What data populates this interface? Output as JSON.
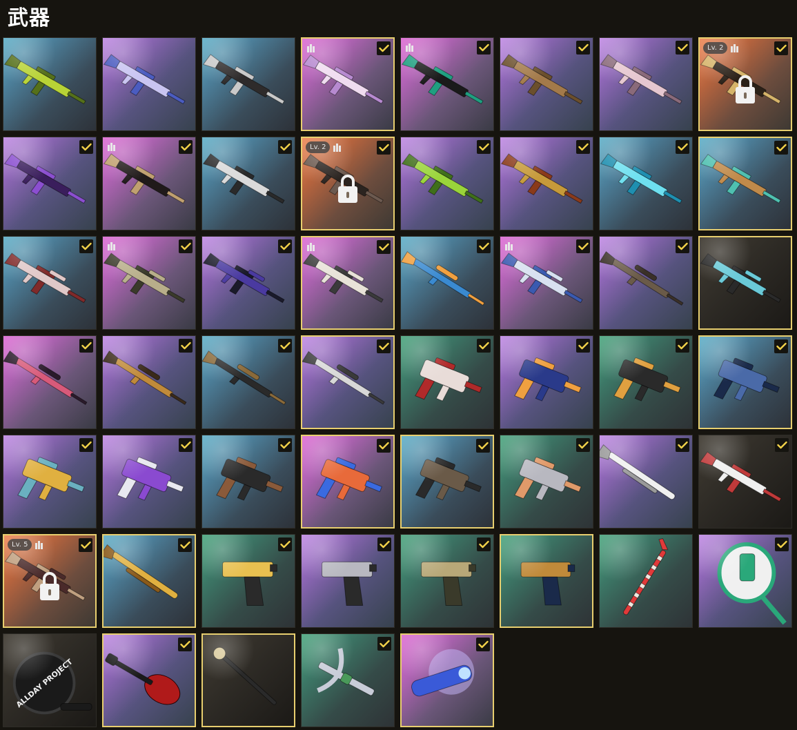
{
  "page_title": "武器",
  "colors": {
    "selected_border": "#e8cf6f",
    "check": "#f2d24a",
    "background": "#16140f"
  },
  "items": [
    {
      "name": "rifle-yellow-camo",
      "rarity": "blue",
      "bg": "blue",
      "selected": false,
      "owned": false,
      "icon": "assault-rifle",
      "colors": [
        "#b8d336",
        "#55701a"
      ]
    },
    {
      "name": "rifle-white-blue",
      "rarity": "purple",
      "bg": "purple",
      "selected": false,
      "owned": false,
      "icon": "assault-rifle",
      "colors": [
        "#c9c4f2",
        "#4b5cc0"
      ]
    },
    {
      "name": "rifle-black-white",
      "rarity": "blue",
      "bg": "blue",
      "selected": false,
      "owned": false,
      "icon": "assault-rifle",
      "colors": [
        "#2e2b2b",
        "#c9c9c9"
      ]
    },
    {
      "name": "rifle-pink-white",
      "rarity": "pink",
      "bg": "pink",
      "selected": true,
      "owned": true,
      "bars": true,
      "icon": "assault-rifle",
      "colors": [
        "#f0dcf0",
        "#b78ad0"
      ]
    },
    {
      "name": "rifle-teal-black",
      "rarity": "pink",
      "bg": "pink",
      "selected": false,
      "owned": true,
      "bars": true,
      "icon": "assault-rifle",
      "colors": [
        "#1a1a1a",
        "#1f9f80"
      ]
    },
    {
      "name": "rifle-bronze",
      "rarity": "purple",
      "bg": "purple",
      "selected": false,
      "owned": true,
      "icon": "assault-rifle",
      "colors": [
        "#a37a4a",
        "#6b4f2c"
      ]
    },
    {
      "name": "rifle-pink-floral",
      "rarity": "purple",
      "bg": "purple",
      "selected": false,
      "owned": true,
      "icon": "assault-rifle",
      "colors": [
        "#e6c7d0",
        "#8a6a7a"
      ]
    },
    {
      "name": "rifle-gold-locked",
      "rarity": "orange",
      "bg": "orange",
      "selected": true,
      "owned": true,
      "locked": true,
      "level": "Lv. 2",
      "bars": true,
      "icon": "assault-rifle",
      "colors": [
        "#2b2118",
        "#d6b46a"
      ]
    },
    {
      "name": "smg-purple-black",
      "rarity": "purple",
      "bg": "purple",
      "selected": false,
      "owned": true,
      "icon": "bullpup",
      "colors": [
        "#3a1e5c",
        "#8b4fd0"
      ]
    },
    {
      "name": "rifle-black-gold",
      "rarity": "pink",
      "bg": "pink",
      "selected": false,
      "owned": true,
      "bars": true,
      "icon": "assault-rifle",
      "colors": [
        "#201a1a",
        "#c0a070"
      ]
    },
    {
      "name": "rifle-white-black",
      "rarity": "blue",
      "bg": "blue",
      "selected": false,
      "owned": true,
      "icon": "assault-rifle",
      "colors": [
        "#dadada",
        "#2a2a2a"
      ]
    },
    {
      "name": "rifle-orange-locked",
      "rarity": "orange",
      "bg": "orange",
      "selected": true,
      "owned": true,
      "locked": true,
      "level": "Lv. 2",
      "bars": true,
      "icon": "assault-rifle",
      "colors": [
        "#2b2420",
        "#6c5a50"
      ]
    },
    {
      "name": "rifle-green-lime",
      "rarity": "purple",
      "bg": "purple",
      "selected": false,
      "owned": true,
      "icon": "assault-rifle",
      "colors": [
        "#9ad43a",
        "#3f6f1a"
      ]
    },
    {
      "name": "rifle-gold-bullpup",
      "rarity": "purple",
      "bg": "purple",
      "selected": false,
      "owned": true,
      "icon": "bullpup",
      "colors": [
        "#c69a3a",
        "#8a3a1a"
      ]
    },
    {
      "name": "rifle-cyan",
      "rarity": "blue",
      "bg": "blue",
      "selected": false,
      "owned": true,
      "icon": "assault-rifle",
      "colors": [
        "#6ee0f0",
        "#1f8fb0"
      ]
    },
    {
      "name": "rifle-m16-teal",
      "rarity": "blue",
      "bg": "blue",
      "selected": true,
      "owned": true,
      "icon": "assault-rifle",
      "colors": [
        "#c08a4a",
        "#4fc0b0"
      ]
    },
    {
      "name": "dmr-floral",
      "rarity": "purple",
      "bg": "blue",
      "selected": false,
      "owned": true,
      "icon": "dmr",
      "colors": [
        "#e0c8c8",
        "#802a2a"
      ]
    },
    {
      "name": "dmr-khaki",
      "rarity": "pink",
      "bg": "pink",
      "selected": false,
      "owned": true,
      "bars": true,
      "icon": "dmr",
      "colors": [
        "#b8ae8a",
        "#3a3a2a"
      ]
    },
    {
      "name": "dmr-purple",
      "rarity": "purple",
      "bg": "purple",
      "selected": false,
      "owned": true,
      "icon": "dmr",
      "colors": [
        "#4a3aa0",
        "#1a1a2a"
      ]
    },
    {
      "name": "dmr-white",
      "rarity": "pink",
      "bg": "pink",
      "selected": true,
      "owned": true,
      "bars": true,
      "icon": "dmr",
      "colors": [
        "#e8e2d8",
        "#3a3a3a"
      ]
    },
    {
      "name": "sniper-blue-orange",
      "rarity": "blue",
      "bg": "blue",
      "selected": false,
      "owned": true,
      "icon": "sniper",
      "colors": [
        "#3a8ad0",
        "#f0a040"
      ]
    },
    {
      "name": "dmr-blue-white",
      "rarity": "pink",
      "bg": "pink",
      "selected": false,
      "owned": true,
      "bars": true,
      "icon": "dmr",
      "colors": [
        "#d8e0f0",
        "#3a5ab0"
      ]
    },
    {
      "name": "sniper-brown",
      "rarity": "purple",
      "bg": "purple",
      "selected": false,
      "owned": true,
      "icon": "sniper",
      "colors": [
        "#6a5a48",
        "#3a3028"
      ]
    },
    {
      "name": "dmr-dark-teal",
      "rarity": "dark",
      "bg": "dark",
      "selected": true,
      "owned": false,
      "icon": "dmr",
      "colors": [
        "#6acad8",
        "#2a2a2a"
      ]
    },
    {
      "name": "sniper-pink",
      "rarity": "pink",
      "bg": "pink",
      "selected": false,
      "owned": true,
      "icon": "sniper",
      "colors": [
        "#d85a7a",
        "#2a1a2a"
      ]
    },
    {
      "name": "sniper-gold",
      "rarity": "purple",
      "bg": "purple",
      "selected": false,
      "owned": true,
      "icon": "sniper",
      "colors": [
        "#c08a3a",
        "#3a2a1a"
      ]
    },
    {
      "name": "sniper-black-wood",
      "rarity": "blue",
      "bg": "blue",
      "selected": false,
      "owned": true,
      "icon": "sniper",
      "colors": [
        "#2a2a2a",
        "#8a6a3a"
      ]
    },
    {
      "name": "sniper-white",
      "rarity": "purple",
      "bg": "purple",
      "selected": true,
      "owned": true,
      "icon": "sniper",
      "colors": [
        "#d8d8d8",
        "#3a3a3a"
      ]
    },
    {
      "name": "smg-white-red",
      "rarity": "green",
      "bg": "green",
      "selected": false,
      "owned": true,
      "icon": "smg",
      "colors": [
        "#e8dcd8",
        "#b02a2a"
      ]
    },
    {
      "name": "pistol-blue-orange",
      "rarity": "purple",
      "bg": "purple",
      "selected": false,
      "owned": true,
      "icon": "smg",
      "colors": [
        "#2a3a8a",
        "#f0a040"
      ]
    },
    {
      "name": "smg-black-orange",
      "rarity": "green",
      "bg": "green",
      "selected": false,
      "owned": true,
      "icon": "smg",
      "colors": [
        "#2a2a2a",
        "#e0a040"
      ]
    },
    {
      "name": "smg-blue-camo",
      "rarity": "blue",
      "bg": "blue",
      "selected": true,
      "owned": true,
      "icon": "smg",
      "colors": [
        "#4a6aa8",
        "#1a2a4a"
      ]
    },
    {
      "name": "smg-graffiti",
      "rarity": "purple",
      "bg": "purple",
      "selected": false,
      "owned": true,
      "icon": "smg",
      "colors": [
        "#e0b040",
        "#6ab0c0"
      ]
    },
    {
      "name": "smg-purple-white",
      "rarity": "purple",
      "bg": "purple",
      "selected": false,
      "owned": true,
      "icon": "smg",
      "colors": [
        "#8a4ad0",
        "#e8e8f0"
      ]
    },
    {
      "name": "smg-tommy",
      "rarity": "blue",
      "bg": "blue",
      "selected": false,
      "owned": true,
      "icon": "smg",
      "colors": [
        "#2a2a2a",
        "#8a5a3a"
      ]
    },
    {
      "name": "smg-rainbow",
      "rarity": "pink",
      "bg": "pink",
      "selected": true,
      "owned": true,
      "icon": "smg",
      "colors": [
        "#e86a3a",
        "#3a6ae0"
      ]
    },
    {
      "name": "lmg-camo",
      "rarity": "blue",
      "bg": "blue",
      "selected": true,
      "owned": true,
      "icon": "lmg",
      "colors": [
        "#6a5a48",
        "#2a2a2a"
      ]
    },
    {
      "name": "shotgun-grey-orange",
      "rarity": "green",
      "bg": "green",
      "selected": false,
      "owned": true,
      "icon": "smg",
      "colors": [
        "#b8b8c0",
        "#e09a6a"
      ]
    },
    {
      "name": "shotgun-white",
      "rarity": "purple",
      "bg": "purple",
      "selected": false,
      "owned": true,
      "icon": "shotgun",
      "colors": [
        "#f0f0f0",
        "#9a9a9a"
      ]
    },
    {
      "name": "rifle-white-red",
      "rarity": "dark",
      "bg": "dark",
      "selected": false,
      "owned": true,
      "icon": "assault-rifle",
      "colors": [
        "#f0f0f0",
        "#c03a3a"
      ]
    },
    {
      "name": "rifle-red-locked",
      "rarity": "orange",
      "bg": "orange",
      "selected": true,
      "owned": true,
      "locked": true,
      "level": "Lv. 5",
      "bars": true,
      "icon": "dmr",
      "colors": [
        "#4a2a2a",
        "#c0a080"
      ]
    },
    {
      "name": "shotgun-gold",
      "rarity": "blue",
      "bg": "blue",
      "selected": true,
      "owned": true,
      "icon": "shotgun",
      "colors": [
        "#e0b040",
        "#8a5a1a"
      ]
    },
    {
      "name": "pistol-deagle-gold",
      "rarity": "green",
      "bg": "green",
      "selected": false,
      "owned": true,
      "icon": "pistol",
      "colors": [
        "#e8c050",
        "#2a2a2a"
      ]
    },
    {
      "name": "pistol-grey",
      "rarity": "purple",
      "bg": "purple",
      "selected": false,
      "owned": true,
      "icon": "pistol",
      "colors": [
        "#b8b8c0",
        "#2a2a2a"
      ]
    },
    {
      "name": "pistol-tan",
      "rarity": "green",
      "bg": "green",
      "selected": false,
      "owned": true,
      "icon": "pistol",
      "colors": [
        "#b8a878",
        "#3a3a2a"
      ]
    },
    {
      "name": "pistol-leopard",
      "rarity": "green",
      "bg": "green",
      "selected": true,
      "owned": false,
      "icon": "pistol",
      "colors": [
        "#c08a3a",
        "#1a2a4a"
      ]
    },
    {
      "name": "crowbar-candy",
      "rarity": "green",
      "bg": "green",
      "selected": false,
      "owned": false,
      "icon": "crowbar",
      "colors": [
        "#e03a3a",
        "#f0e8e0"
      ]
    },
    {
      "name": "racket-green",
      "rarity": "purple",
      "bg": "purple",
      "selected": false,
      "owned": true,
      "icon": "racket",
      "colors": [
        "#2aa87a",
        "#f0f0f0"
      ]
    },
    {
      "name": "pan-allday-project",
      "rarity": "dark",
      "bg": "dark",
      "selected": false,
      "owned": false,
      "icon": "pan",
      "label": "ALLDAY PROJECT",
      "colors": [
        "#1a1a1a",
        "#f0f0f0"
      ]
    },
    {
      "name": "guitar-red",
      "rarity": "purple",
      "bg": "purple",
      "selected": true,
      "owned": true,
      "icon": "guitar",
      "colors": [
        "#b01a1a",
        "#1a1a1a"
      ]
    },
    {
      "name": "cane-gold",
      "rarity": "dark",
      "bg": "dark",
      "selected": true,
      "owned": false,
      "icon": "cane",
      "colors": [
        "#d8c898",
        "#2a2a2a"
      ]
    },
    {
      "name": "crossbow-grey",
      "rarity": "green",
      "bg": "green",
      "selected": false,
      "owned": true,
      "icon": "crossbow",
      "colors": [
        "#c8ccd8",
        "#4a9a5a"
      ]
    },
    {
      "name": "launcher-blue-smoke",
      "rarity": "pink",
      "bg": "pink",
      "selected": true,
      "owned": true,
      "icon": "launcher",
      "colors": [
        "#3a5ad8",
        "#c0b0f0"
      ]
    }
  ]
}
